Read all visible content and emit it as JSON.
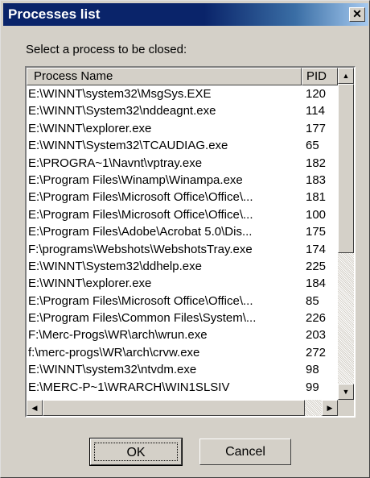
{
  "window": {
    "title": "Processes list",
    "close_glyph": "✕"
  },
  "prompt": "Select a process to be closed:",
  "table": {
    "columns": [
      "Process Name",
      "PID"
    ],
    "rows": [
      {
        "name": "E:\\WINNT\\system32\\MsgSys.EXE",
        "pid": "120"
      },
      {
        "name": "E:\\WINNT\\System32\\nddeagnt.exe",
        "pid": "114"
      },
      {
        "name": "E:\\WINNT\\explorer.exe",
        "pid": "177"
      },
      {
        "name": "E:\\WINNT\\System32\\TCAUDIAG.exe",
        "pid": "65"
      },
      {
        "name": "E:\\PROGRA~1\\Navnt\\vptray.exe",
        "pid": "182"
      },
      {
        "name": "E:\\Program Files\\Winamp\\Winampa.exe",
        "pid": "183"
      },
      {
        "name": "E:\\Program Files\\Microsoft Office\\Office\\...",
        "pid": "181"
      },
      {
        "name": "E:\\Program Files\\Microsoft Office\\Office\\...",
        "pid": "100"
      },
      {
        "name": "E:\\Program Files\\Adobe\\Acrobat 5.0\\Dis...",
        "pid": "175"
      },
      {
        "name": "F:\\programs\\Webshots\\WebshotsTray.exe",
        "pid": "174"
      },
      {
        "name": "E:\\WINNT\\System32\\ddhelp.exe",
        "pid": "225"
      },
      {
        "name": "E:\\WINNT\\explorer.exe",
        "pid": "184"
      },
      {
        "name": "E:\\Program Files\\Microsoft Office\\Office\\...",
        "pid": "85"
      },
      {
        "name": "E:\\Program Files\\Common Files\\System\\...",
        "pid": "226"
      },
      {
        "name": "F:\\Merc-Progs\\WR\\arch\\wrun.exe",
        "pid": "203"
      },
      {
        "name": "f:\\merc-progs\\WR\\arch\\crvw.exe",
        "pid": "272"
      },
      {
        "name": "E:\\WINNT\\system32\\ntvdm.exe",
        "pid": "98"
      },
      {
        "name": "E:\\MERC-P~1\\WRARCH\\WIN1SLSIV",
        "pid": "99"
      }
    ]
  },
  "scrollbar": {
    "up_glyph": "▲",
    "down_glyph": "▼",
    "left_glyph": "◀",
    "right_glyph": "▶"
  },
  "buttons": {
    "ok": "OK",
    "cancel": "Cancel"
  },
  "colors": {
    "titlebar": "#0a246a",
    "face": "#d4d0c8"
  }
}
